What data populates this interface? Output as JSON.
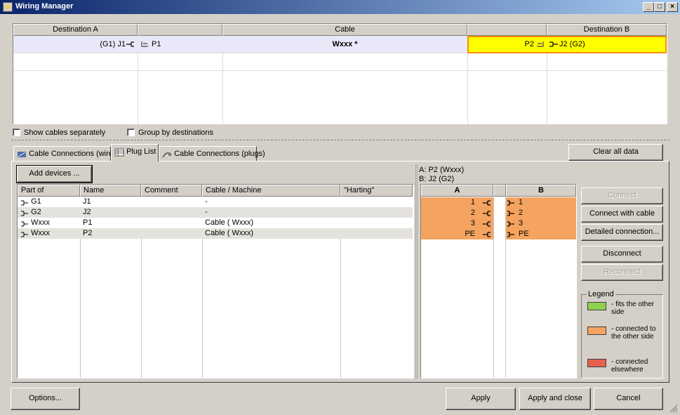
{
  "window": {
    "title": "Wiring Manager",
    "minimize": "_",
    "maximize": "□",
    "close": "×"
  },
  "top_grid": {
    "headers": [
      "Destination A",
      "",
      "Cable",
      "",
      "Destination B"
    ],
    "row": {
      "dest_a": "(G1) J1",
      "plug_a": "P1",
      "cable": "Wxxx *",
      "plug_b": "P2",
      "dest_b": "J2 (G2)"
    }
  },
  "options": {
    "show_cables_separately": "Show cables separately",
    "group_by_destinations": "Group by destinations"
  },
  "tabs": [
    {
      "label": "Cable Connections (wires)",
      "icon": "cable-wires-icon"
    },
    {
      "label": "Plug List",
      "icon": "grid-list-icon"
    },
    {
      "label": "Cable Connections (plugs)",
      "icon": "cable-plugs-icon"
    }
  ],
  "clear_all_data": "Clear all data",
  "add_devices": "Add devices ...",
  "plug_list": {
    "headers": [
      "Part of",
      "Name",
      "Comment",
      "Cable / Machine",
      "\"Harting\""
    ],
    "rows": [
      {
        "part_of": "G1",
        "name": "J1",
        "comment": "",
        "cable": "-",
        "harting": ""
      },
      {
        "part_of": "G2",
        "name": "J2",
        "comment": "",
        "cable": "-",
        "harting": ""
      },
      {
        "part_of": "Wxxx",
        "name": "P1",
        "comment": "",
        "cable": "Cable ( Wxxx)",
        "harting": ""
      },
      {
        "part_of": "Wxxx",
        "name": "P2",
        "comment": "",
        "cable": "Cable ( Wxxx)",
        "harting": ""
      }
    ]
  },
  "connection": {
    "a_label": "A: P2 (Wxxx)",
    "b_label": "B: J2 (G2)",
    "col_a": "A",
    "col_b": "B",
    "rows": [
      {
        "a": "1",
        "b": "1"
      },
      {
        "a": "2",
        "b": "2"
      },
      {
        "a": "3",
        "b": "3"
      },
      {
        "a": "PE",
        "b": "PE"
      }
    ],
    "row_color": "#f4a460"
  },
  "side_buttons": {
    "connect": "Connect",
    "connect_with_cable": "Connect with cable",
    "detailed_connection": "Detailed connection...",
    "disconnect": "Disconnect",
    "reconnect": "Reconnect"
  },
  "legend": {
    "title": "Legend",
    "items": [
      {
        "color": "#8fd14f",
        "text": "- fits the other side"
      },
      {
        "color": "#f4a460",
        "text": "- connected to the other side"
      },
      {
        "color": "#e8604c",
        "text": "- connected elsewhere"
      }
    ]
  },
  "footer": {
    "options": "Options...",
    "apply": "Apply",
    "apply_and_close": "Apply and close",
    "cancel": "Cancel"
  },
  "colors": {
    "selected_row": "#e8e8f8",
    "highlight_cell": "#ffff00",
    "highlight_border": "#ff8c00"
  }
}
